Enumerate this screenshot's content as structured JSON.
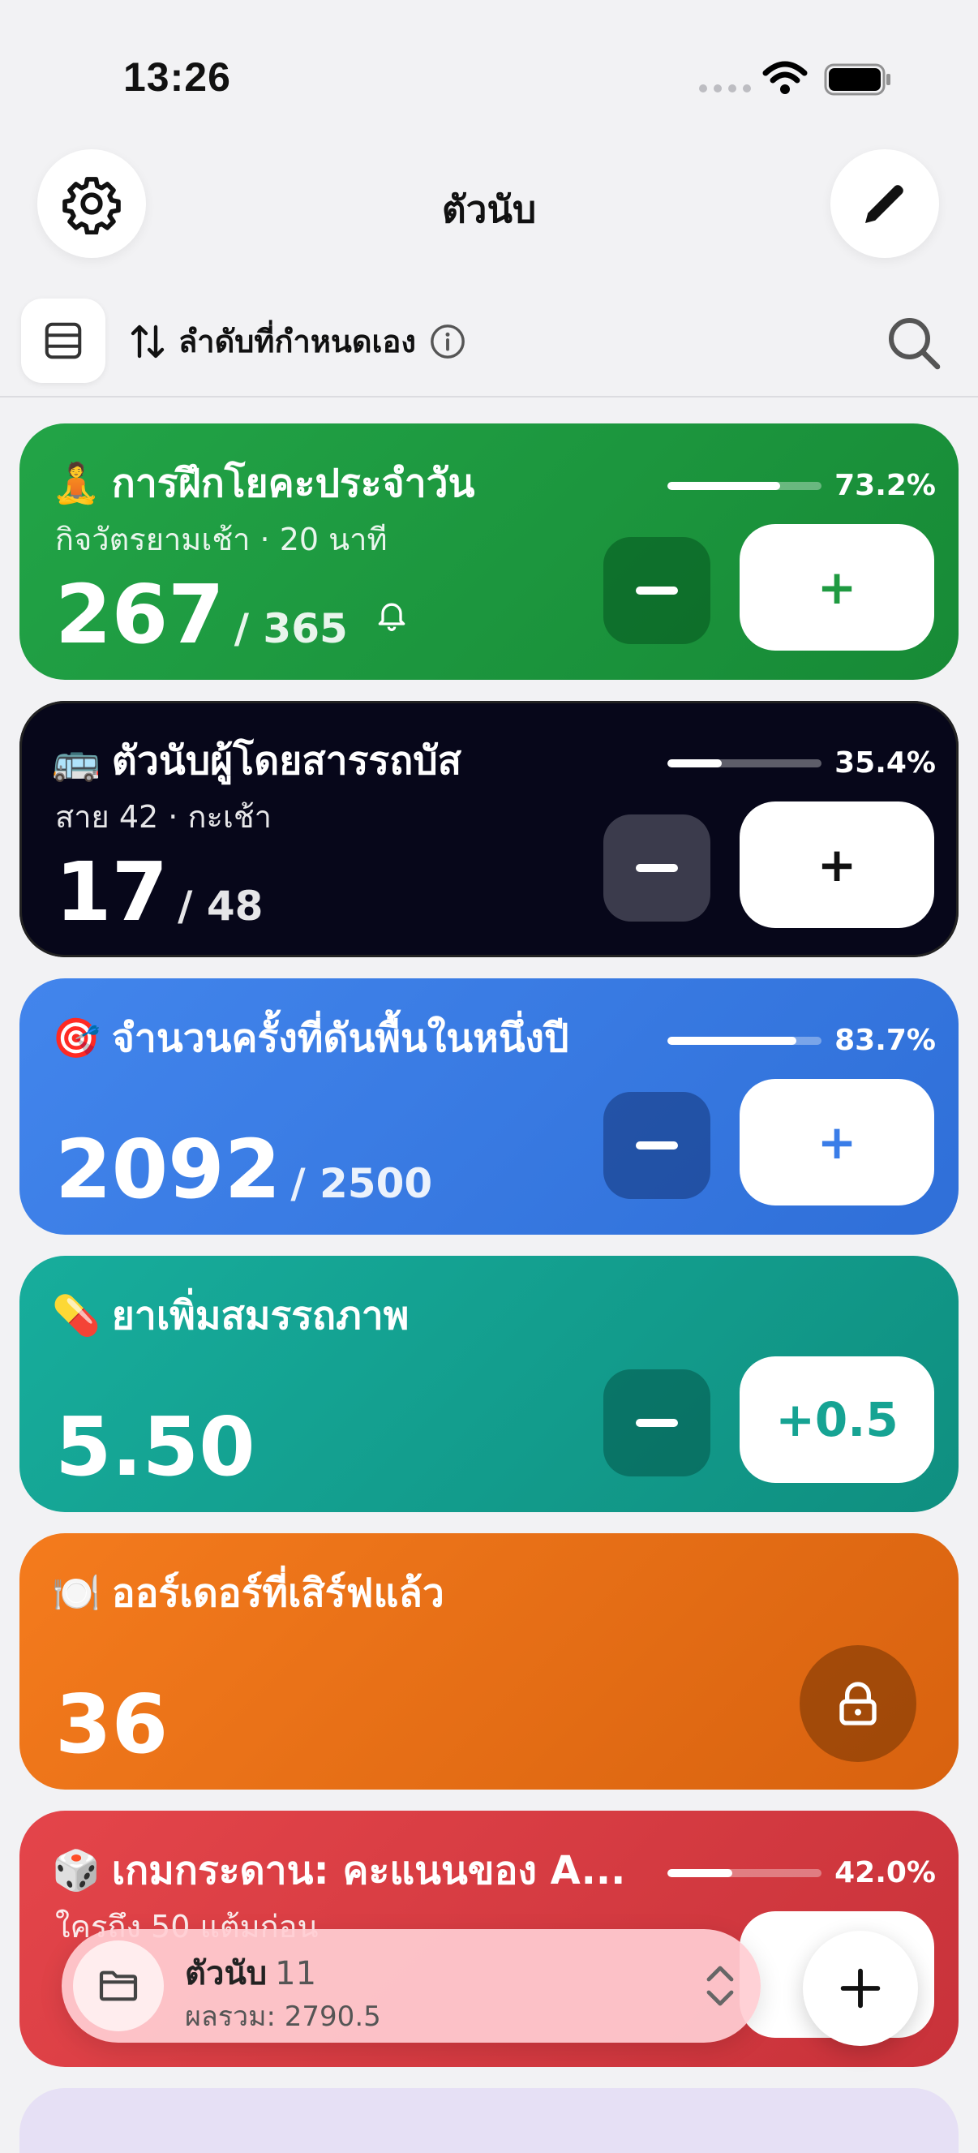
{
  "status": {
    "time": "13:26"
  },
  "header": {
    "title": "ตัวนับ"
  },
  "toolbar": {
    "sort_label": "ลำดับที่กำหนดเอง"
  },
  "counters": [
    {
      "emoji": "🧘",
      "title": "การฝึกโยคะประจำวัน",
      "subtitle": "กิจวัตรยามเช้า · 20 นาที",
      "value": "267",
      "target": "/ 365",
      "progress_label": "73.2%",
      "progress": 0.732,
      "color": "#1f9a41",
      "plus_label": "+"
    },
    {
      "emoji": "🚌",
      "title": "ตัวนับผู้โดยสารรถบัส",
      "subtitle": "สาย 42 · กะเช้า",
      "value": "17",
      "target": "/ 48",
      "progress_label": "35.4%",
      "progress": 0.354,
      "color": "#0a0a1c",
      "plus_label": "+"
    },
    {
      "emoji": "🎯",
      "title": "จำนวนครั้งที่ดันพื้นในหนึ่งปี",
      "subtitle": "",
      "value": "2092",
      "target": "/ 2500",
      "progress_label": "83.7%",
      "progress": 0.837,
      "color": "#3a7de8",
      "plus_label": "+"
    },
    {
      "emoji": "💊",
      "title": "ยาเพิ่มสมรรถภาพ",
      "subtitle": "",
      "value": "5.50",
      "target": "",
      "color": "#16a393",
      "plus_label": "+0.5"
    },
    {
      "emoji": "🍽️",
      "title": "ออร์เดอร์ที่เสิร์ฟแล้ว",
      "subtitle": "",
      "value": "36",
      "target": "",
      "color": "#ef7419",
      "locked": true
    },
    {
      "emoji": "🎲",
      "title": "เกมกระดาน: คะแนนของ A...",
      "subtitle": "ใครถึง 50 แต้มก่อน",
      "value": "",
      "target": "",
      "progress_label": "42.0%",
      "progress": 0.42,
      "color": "#dc3b3f",
      "plus_label": "+"
    }
  ],
  "bottom_bar": {
    "title": "ตัวนับ",
    "count": "11",
    "sum": "ผลรวม: 2790.5"
  }
}
